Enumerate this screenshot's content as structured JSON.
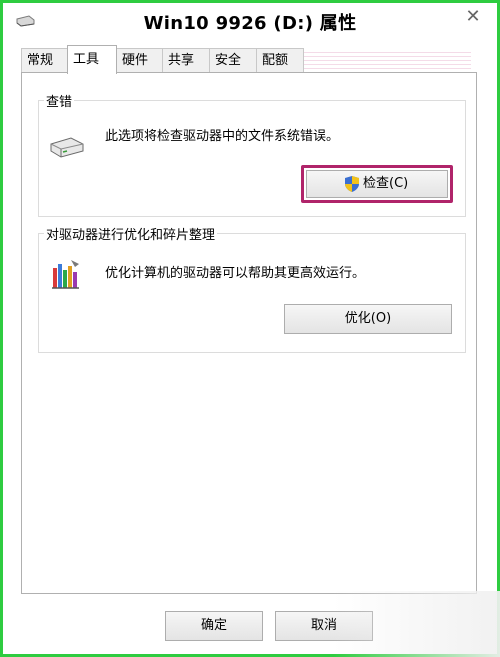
{
  "window": {
    "title": "Win10 9926 (D:) 属性",
    "close_symbol": "✕"
  },
  "tabs": [
    {
      "label": "常规",
      "active": false
    },
    {
      "label": "工具",
      "active": true
    },
    {
      "label": "硬件",
      "active": false
    },
    {
      "label": "共享",
      "active": false
    },
    {
      "label": "安全",
      "active": false
    },
    {
      "label": "配额",
      "active": false
    }
  ],
  "error_check": {
    "group_title": "查错",
    "description": "此选项将检查驱动器中的文件系统错误。",
    "button_label": "检查(C)",
    "icon": "drive-icon",
    "button_icon": "uac-shield-icon"
  },
  "optimize": {
    "group_title": "对驱动器进行优化和碎片整理",
    "description": "优化计算机的驱动器可以帮助其更高效运行。",
    "button_label": "优化(O)",
    "icon": "defrag-icon"
  },
  "footer": {
    "ok_label": "确定",
    "cancel_label": "取消"
  },
  "colors": {
    "highlight_border": "#b0246a",
    "window_border": "#2ecc40"
  }
}
